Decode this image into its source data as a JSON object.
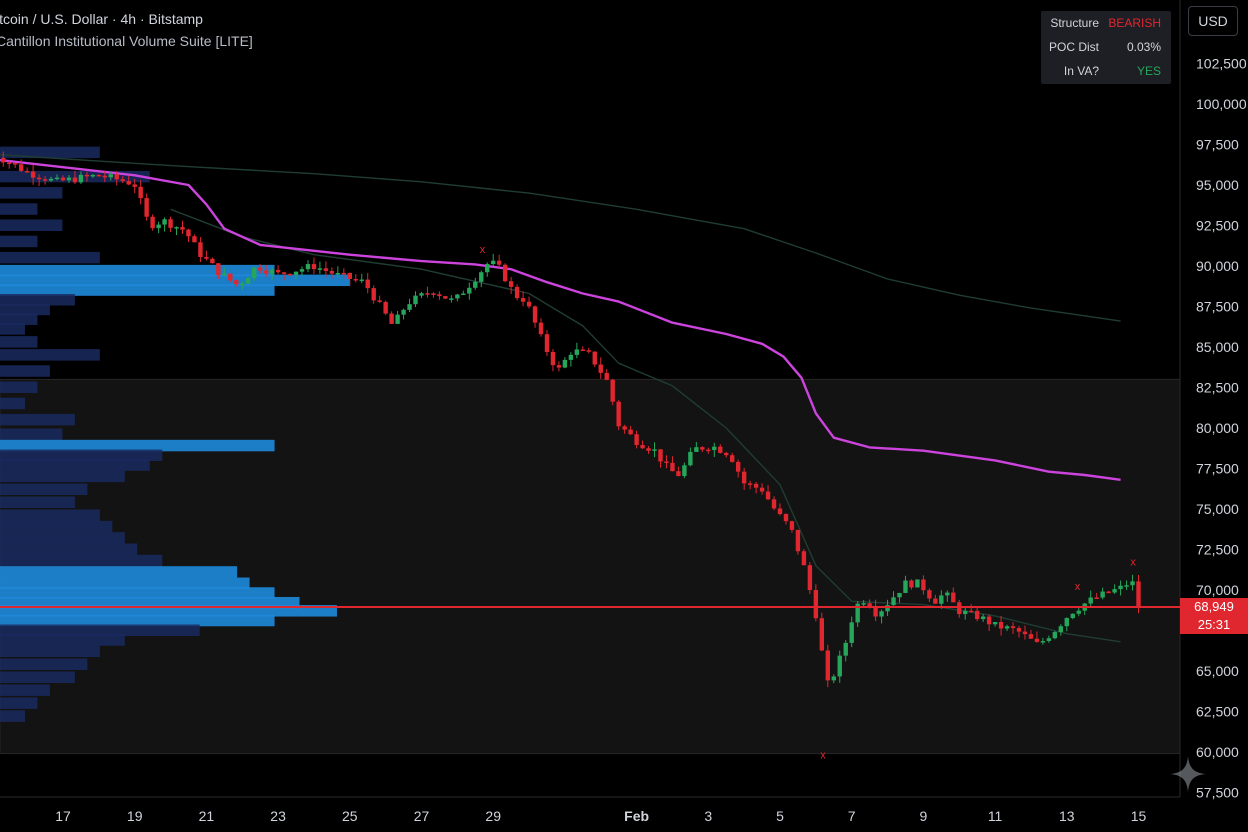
{
  "header": {
    "symbol_line": "itcoin / U.S. Dollar · 4h · Bitstamp",
    "indicator_line": "Cantillon Institutional Volume Suite [LITE]"
  },
  "currency_button": "USD",
  "info_table": {
    "rows": [
      {
        "label": "Structure",
        "value": "BEARISH",
        "color": "#e0262f"
      },
      {
        "label": "POC Dist",
        "value": "0.03%",
        "color": "#d1d4dc"
      },
      {
        "label": "In VA?",
        "value": "YES",
        "color": "#26a65b"
      }
    ]
  },
  "price_tag": {
    "price": "68,949",
    "countdown": "25:31"
  },
  "colors": {
    "up": "#26a65b",
    "down": "#e0262f",
    "vwap": "#cc44dd",
    "band": "#1f3d33",
    "poc": "#e0262f",
    "profile_hi": "#1e88d8",
    "profile_lo": "#1a2a60"
  },
  "chart_data": {
    "type": "candlestick",
    "yaxis": {
      "ticks": [
        102500,
        100000,
        97500,
        95000,
        92500,
        90000,
        87500,
        85000,
        82500,
        80000,
        77500,
        75000,
        72500,
        70000,
        65000,
        62500,
        60000,
        57500
      ],
      "tick_labels": [
        "102,500",
        "100,000",
        "97,500",
        "95,000",
        "92,500",
        "90,000",
        "87,500",
        "85,000",
        "82,500",
        "80,000",
        "77,500",
        "75,000",
        "72,500",
        "70,000",
        "65,000",
        "62,500",
        "60,000",
        "57,500"
      ],
      "range": [
        57000,
        104500
      ]
    },
    "xaxis": {
      "tick_labels": [
        "17",
        "19",
        "21",
        "23",
        "25",
        "27",
        "29",
        "Feb",
        "3",
        "5",
        "7",
        "9",
        "11",
        "13",
        "15"
      ],
      "tick_days": [
        -15,
        -13,
        -11,
        -9,
        -7,
        -5,
        -3,
        1,
        3,
        5,
        7,
        9,
        11,
        13,
        15
      ],
      "range_days": [
        -17,
        15.5
      ]
    },
    "last_price": 68949,
    "poc_price": 68949,
    "value_area": {
      "low": 59900,
      "high": 83000
    },
    "ohlc_path": [
      [
        -17,
        97000
      ],
      [
        -16,
        95800
      ],
      [
        -15.2,
        95200
      ],
      [
        -14,
        95600
      ],
      [
        -13.2,
        95200
      ],
      [
        -13,
        95000
      ],
      [
        -12.6,
        92500
      ],
      [
        -12.2,
        92800
      ],
      [
        -11.6,
        92200
      ],
      [
        -11.2,
        90800
      ],
      [
        -10.6,
        89500
      ],
      [
        -10.1,
        88800
      ],
      [
        -9.6,
        90000
      ],
      [
        -9,
        89500
      ],
      [
        -8,
        90000
      ],
      [
        -7.3,
        89400
      ],
      [
        -6.6,
        89000
      ],
      [
        -5.8,
        86300
      ],
      [
        -5.4,
        87700
      ],
      [
        -4.7,
        88500
      ],
      [
        -4.1,
        87800
      ],
      [
        -3.6,
        89000
      ],
      [
        -3.1,
        90300
      ],
      [
        -2.8,
        89800
      ],
      [
        -2.4,
        88200
      ],
      [
        -2.1,
        87900
      ],
      [
        -1.6,
        85200
      ],
      [
        -1.2,
        83500
      ],
      [
        -0.8,
        84800
      ],
      [
        -0.3,
        84500
      ],
      [
        0.2,
        82800
      ],
      [
        0.5,
        80200
      ],
      [
        1.0,
        79200
      ],
      [
        1.5,
        78600
      ],
      [
        1.9,
        77400
      ],
      [
        2.2,
        77100
      ],
      [
        2.6,
        78700
      ],
      [
        3.1,
        78900
      ],
      [
        3.6,
        78400
      ],
      [
        4.0,
        76600
      ],
      [
        4.5,
        76200
      ],
      [
        4.9,
        74800
      ],
      [
        5.3,
        73800
      ],
      [
        5.7,
        71200
      ],
      [
        6.0,
        68500
      ],
      [
        6.2,
        65700
      ],
      [
        6.35,
        64000
      ],
      [
        6.5,
        64800
      ],
      [
        6.8,
        66500
      ],
      [
        7.1,
        69000
      ],
      [
        7.4,
        69500
      ],
      [
        7.7,
        68500
      ],
      [
        8.0,
        69200
      ],
      [
        8.5,
        70400
      ],
      [
        8.9,
        70400
      ],
      [
        9.3,
        69300
      ],
      [
        9.6,
        69800
      ],
      [
        10.0,
        68700
      ],
      [
        10.6,
        68300
      ],
      [
        11.0,
        67800
      ],
      [
        11.6,
        67500
      ],
      [
        12.2,
        66600
      ],
      [
        12.7,
        67600
      ],
      [
        13.1,
        68600
      ],
      [
        13.6,
        69300
      ],
      [
        14.1,
        69800
      ],
      [
        14.6,
        70200
      ],
      [
        14.8,
        70700
      ],
      [
        15.0,
        68949
      ]
    ],
    "vwap_line": [
      [
        -17,
        96600
      ],
      [
        -15,
        96100
      ],
      [
        -13,
        95600
      ],
      [
        -11.5,
        95000
      ],
      [
        -11,
        93800
      ],
      [
        -10.5,
        92300
      ],
      [
        -9.5,
        91300
      ],
      [
        -7,
        90700
      ],
      [
        -5,
        90300
      ],
      [
        -3.5,
        90100
      ],
      [
        -2.5,
        89800
      ],
      [
        -1.5,
        89000
      ],
      [
        -0.5,
        88300
      ],
      [
        0.5,
        87800
      ],
      [
        2,
        86500
      ],
      [
        3.5,
        85800
      ],
      [
        4.5,
        85200
      ],
      [
        5.1,
        84400
      ],
      [
        5.6,
        83100
      ],
      [
        6.0,
        80900
      ],
      [
        6.5,
        79400
      ],
      [
        7.5,
        78800
      ],
      [
        9,
        78600
      ],
      [
        11,
        78000
      ],
      [
        12.5,
        77300
      ],
      [
        13.5,
        77100
      ],
      [
        14.5,
        76800
      ]
    ],
    "upper_band": [
      [
        -17,
        96900
      ],
      [
        -12,
        96200
      ],
      [
        -8,
        95700
      ],
      [
        -5,
        95200
      ],
      [
        -2,
        94500
      ],
      [
        1,
        93500
      ],
      [
        4,
        92300
      ],
      [
        6,
        90800
      ],
      [
        8,
        89200
      ],
      [
        10,
        88200
      ],
      [
        12,
        87400
      ],
      [
        14.5,
        86600
      ]
    ],
    "lower_band": [
      [
        -12,
        93500
      ],
      [
        -10,
        91800
      ],
      [
        -8,
        90700
      ],
      [
        -5,
        89800
      ],
      [
        -2,
        88300
      ],
      [
        -0.5,
        86300
      ],
      [
        0.5,
        84000
      ],
      [
        2,
        82600
      ],
      [
        3.5,
        80000
      ],
      [
        5,
        76500
      ],
      [
        6,
        71500
      ],
      [
        7,
        69300
      ],
      [
        9,
        69100
      ],
      [
        11,
        68400
      ],
      [
        13,
        67300
      ],
      [
        14.5,
        66800
      ]
    ],
    "volume_profile": [
      [
        97000,
        0.08
      ],
      [
        95500,
        0.12
      ],
      [
        94500,
        0.05
      ],
      [
        93500,
        0.03
      ],
      [
        92500,
        0.05
      ],
      [
        91500,
        0.03
      ],
      [
        90500,
        0.08
      ],
      [
        89700,
        0.22
      ],
      [
        89100,
        0.28
      ],
      [
        88500,
        0.22
      ],
      [
        87900,
        0.06
      ],
      [
        87300,
        0.04
      ],
      [
        86700,
        0.03
      ],
      [
        86100,
        0.02
      ],
      [
        85300,
        0.03
      ],
      [
        84500,
        0.08
      ],
      [
        83500,
        0.04
      ],
      [
        82500,
        0.03
      ],
      [
        81500,
        0.02
      ],
      [
        80500,
        0.06
      ],
      [
        79600,
        0.05
      ],
      [
        78900,
        0.22
      ],
      [
        78300,
        0.13
      ],
      [
        77700,
        0.12
      ],
      [
        77000,
        0.1
      ],
      [
        76200,
        0.07
      ],
      [
        75400,
        0.06
      ],
      [
        74600,
        0.08
      ],
      [
        73900,
        0.09
      ],
      [
        73200,
        0.1
      ],
      [
        72500,
        0.11
      ],
      [
        71800,
        0.13
      ],
      [
        71100,
        0.19
      ],
      [
        70400,
        0.2
      ],
      [
        69800,
        0.22
      ],
      [
        69200,
        0.24
      ],
      [
        68700,
        0.27
      ],
      [
        68100,
        0.22
      ],
      [
        67500,
        0.16
      ],
      [
        66900,
        0.1
      ],
      [
        66200,
        0.08
      ],
      [
        65400,
        0.07
      ],
      [
        64600,
        0.06
      ],
      [
        63800,
        0.04
      ],
      [
        63000,
        0.03
      ],
      [
        62200,
        0.02
      ]
    ],
    "markers": [
      {
        "day": -3.3,
        "price": 90800,
        "label": "x"
      },
      {
        "day": 6.2,
        "price": 59600,
        "label": "x"
      },
      {
        "day": 13.3,
        "price": 70000,
        "label": "x"
      },
      {
        "day": 14.85,
        "price": 71500,
        "label": "x"
      }
    ],
    "grid": false
  }
}
